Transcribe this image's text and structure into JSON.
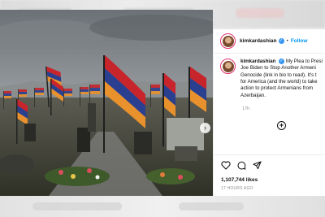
{
  "post": {
    "username": "kimkardashian",
    "separator": "•",
    "follow_label": "Follow",
    "caption_user": "kimkardashian",
    "caption_lines": [
      "My Plea to Presi",
      "Joe Biden to Stop Another Armeni",
      "Genocide (link in bio to read). It's t",
      "for America (and the world) to take",
      "action to protect Armenians from",
      "Azerbaijan."
    ],
    "time": "17h",
    "likes": "1,107,744 likes",
    "posted_ago": "17 HOURS AGO",
    "carousel": {
      "total": 4,
      "active": 1
    }
  },
  "icons": {
    "verified": "verified-badge-icon",
    "next": "chevron-right-icon",
    "add": "plus-circle-icon",
    "like": "heart-icon",
    "comment": "comment-icon",
    "share": "share-icon"
  },
  "colors": {
    "follow": "#0095f6",
    "verified": "#3897f0",
    "flag_red": "#c8242b",
    "flag_blue": "#2a3f8f",
    "flag_orange": "#e8912d"
  }
}
